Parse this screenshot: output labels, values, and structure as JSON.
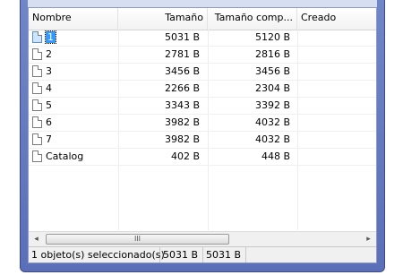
{
  "columns": {
    "name": "Nombre",
    "size": "Tamaño",
    "compressed": "Tamaño comp...",
    "created": "Creado"
  },
  "files": [
    {
      "name": "1",
      "size": "5031 B",
      "compressed": "5120 B",
      "selected": true
    },
    {
      "name": "2",
      "size": "2781 B",
      "compressed": "2816 B"
    },
    {
      "name": "3",
      "size": "3456 B",
      "compressed": "3456 B"
    },
    {
      "name": "4",
      "size": "2266 B",
      "compressed": "2304 B"
    },
    {
      "name": "5",
      "size": "3343 B",
      "compressed": "3392 B"
    },
    {
      "name": "6",
      "size": "3982 B",
      "compressed": "4032 B"
    },
    {
      "name": "7",
      "size": "3982 B",
      "compressed": "4032 B"
    },
    {
      "name": "Catalog",
      "size": "402 B",
      "compressed": "448 B"
    }
  ],
  "scrollbar": {
    "left_arrow": "◂",
    "right_arrow": "▸",
    "grip": "III"
  },
  "status": {
    "selection": "1 objeto(s) seleccionado(s)",
    "size": "5031 B",
    "compressed": "5031 B"
  }
}
